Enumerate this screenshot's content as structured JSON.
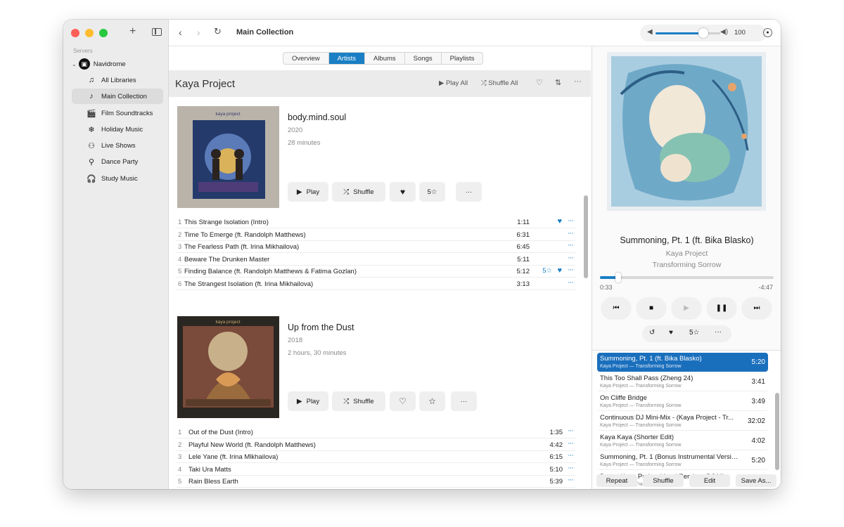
{
  "topbar": {
    "title": "Main Collection",
    "volume": "100",
    "volume_fraction": 0.74
  },
  "sidebar": {
    "section": "Servers",
    "server": "Navidrome",
    "items": [
      {
        "label": "All Libraries",
        "icon": "music-notes-icon",
        "glyph": "♫"
      },
      {
        "label": "Main Collection",
        "icon": "music-note-box-icon",
        "glyph": "♪"
      },
      {
        "label": "Film Soundtracks",
        "icon": "clapperboard-icon",
        "glyph": "🎬"
      },
      {
        "label": "Holiday Music",
        "icon": "snowflake-icon",
        "glyph": "❄"
      },
      {
        "label": "Live Shows",
        "icon": "crowd-icon",
        "glyph": "⚇"
      },
      {
        "label": "Dance Party",
        "icon": "dancer-icon",
        "glyph": "⚲"
      },
      {
        "label": "Study Music",
        "icon": "headphones-icon",
        "glyph": "🎧"
      }
    ]
  },
  "tabs": [
    "Overview",
    "Artists",
    "Albums",
    "Songs",
    "Playlists"
  ],
  "artist": {
    "name": "Kaya Project",
    "play_all": "Play All",
    "shuffle_all": "Shuffle All"
  },
  "albums": [
    {
      "title": "body.mind.soul",
      "year": "2020",
      "length": "28 minutes",
      "cover_brand": "kaya project",
      "play": "Play",
      "shuffle": "Shuffle",
      "rating": "5☆",
      "tracks": [
        {
          "n": "1",
          "title": "This Strange Isolation (Intro)",
          "dur": "1:11",
          "heart": true,
          "rating": ""
        },
        {
          "n": "2",
          "title": "Time To Emerge (ft. Randolph Matthews)",
          "dur": "6:31",
          "heart": false,
          "rating": ""
        },
        {
          "n": "3",
          "title": "The Fearless Path (ft. Irina Mikhailova)",
          "dur": "6:45",
          "heart": false,
          "rating": ""
        },
        {
          "n": "4",
          "title": "Beware The Drunken Master",
          "dur": "5:11",
          "heart": false,
          "rating": ""
        },
        {
          "n": "5",
          "title": "Finding Balance (ft. Randolph Matthews & Fatima Gozlan)",
          "dur": "5:12",
          "heart": true,
          "rating": "5☆"
        },
        {
          "n": "6",
          "title": "The Strangest Isolation (ft. Irina Mikhailova)",
          "dur": "3:13",
          "heart": false,
          "rating": ""
        }
      ]
    },
    {
      "title": "Up from the Dust",
      "year": "2018",
      "length": "2 hours, 30 minutes",
      "cover_brand": "kaya project",
      "play": "Play",
      "shuffle": "Shuffle",
      "rating": "",
      "tracks": [
        {
          "n": "1",
          "title": "Out of the Dust (Intro)",
          "dur": "1:35"
        },
        {
          "n": "2",
          "title": "Playful New World (ft. Randolph Matthews)",
          "dur": "4:42"
        },
        {
          "n": "3",
          "title": "Lele Yane (ft. Irina Mlkhailova)",
          "dur": "6:15"
        },
        {
          "n": "4",
          "title": "Taki Ura Matts",
          "dur": "5:10"
        },
        {
          "n": "5",
          "title": "Rain Bless Earth",
          "dur": "5:39"
        }
      ]
    }
  ],
  "now_playing": {
    "title": "Summoning, Pt. 1 (ft. Bika Blasko)",
    "artist": "Kaya Project",
    "album": "Transforming Sorrow",
    "elapsed": "0:33",
    "remaining": "-4:47",
    "progress_fraction": 0.105,
    "rating": "5☆"
  },
  "queue": [
    {
      "title": "Summoning, Pt. 1 (ft. Bika Blasko)",
      "sub": "Kaya Project — Transforming Sorrow",
      "dur": "5:20",
      "active": true
    },
    {
      "title": "This Too Shall Pass (Zheng 24)",
      "sub": "Kaya Project — Transforming Sorrow",
      "dur": "3:41"
    },
    {
      "title": "On Cliffe Bridge",
      "sub": "Kaya Project — Transforming Sorrow",
      "dur": "3:49"
    },
    {
      "title": "Continuous DJ Mini-Mix - (Kaya Project - Tr...",
      "sub": "Kaya Project — Transforming Sorrow",
      "dur": "32:02"
    },
    {
      "title": "Kaya Kaya (Shorter Edit)",
      "sub": "Kaya Project — Transforming Sorrow",
      "dur": "4:02"
    },
    {
      "title": "Summoning, Pt. 1 (Bonus Instrumental Versio...",
      "sub": "Kaya Project — Transforming Sorrow",
      "dur": "5:20"
    },
    {
      "title": "Bonus Kaya Project Vocal Remixes DJ Mix",
      "sub": "Kaya Project — Transforming Sorrow",
      "dur": "41:03"
    }
  ],
  "queue_buttons": [
    "Repeat",
    "Shuffle",
    "Edit",
    "Save As..."
  ],
  "colors": {
    "accent": "#1a7fc4",
    "active_queue": "#1a6fbd"
  }
}
